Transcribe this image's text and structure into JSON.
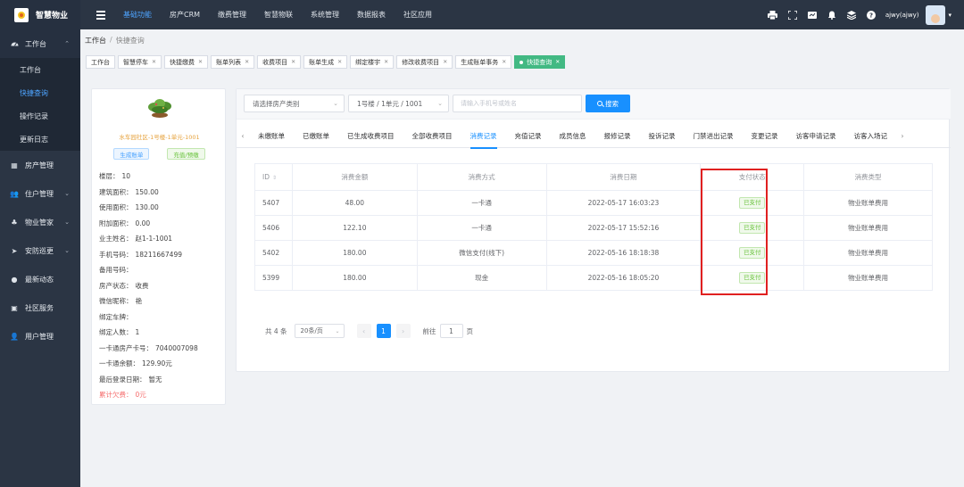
{
  "app": {
    "title": "智慧物业"
  },
  "topnav": [
    "基础功能",
    "房产CRM",
    "缴费管理",
    "智慧物联",
    "系统管理",
    "数据报表",
    "社区应用"
  ],
  "topnav_active": 0,
  "user": {
    "name": "ajwy(ajwy)"
  },
  "sidebar": {
    "workbench": {
      "label": "工作台",
      "items": [
        "工作台",
        "快捷查询",
        "操作记录",
        "更新日志"
      ],
      "active": 1
    },
    "groups": [
      "房产管理",
      "住户管理",
      "物业管家",
      "安防巡更",
      "最新动态",
      "社区服务",
      "用户管理"
    ]
  },
  "breadcrumb": {
    "root": "工作台",
    "sep": "/",
    "current": "快捷查询"
  },
  "tabs": [
    "工作台",
    "智慧停车",
    "快捷缴费",
    "账单列表",
    "收费项目",
    "账单生成",
    "绑定楼宇",
    "修改收费项目",
    "生成账单事务",
    "快捷查询"
  ],
  "house": {
    "name": "水车园社区-1号楼-1单元-1001",
    "btn_generate": "生成账单",
    "btn_recharge": "充值/预缴",
    "fields": [
      {
        "k": "楼层：",
        "v": "10"
      },
      {
        "k": "建筑面积：",
        "v": "150.00"
      },
      {
        "k": "使用面积：",
        "v": "130.00"
      },
      {
        "k": "附加面积：",
        "v": "0.00"
      },
      {
        "k": "业主姓名：",
        "v": "赵1-1-1001"
      },
      {
        "k": "手机号码：",
        "v": "18211667499"
      },
      {
        "k": "备用号码：",
        "v": ""
      },
      {
        "k": "房产状态：",
        "v": "收费"
      },
      {
        "k": "微信昵称：",
        "v": "艳"
      },
      {
        "k": "绑定车牌：",
        "v": ""
      },
      {
        "k": "绑定人数：",
        "v": "1"
      },
      {
        "k": "一卡通房产卡号：",
        "v": "7040007098"
      },
      {
        "k": "一卡通余额：",
        "v": "129.90元"
      },
      {
        "k": "最后登录日期：",
        "v": "暂无"
      }
    ],
    "arrears": {
      "k": "累计欠费：",
      "v": "0元"
    }
  },
  "filter": {
    "house_type_placeholder": "请选择房产类别",
    "building": "1号楼 / 1单元 / 1001",
    "search_placeholder": "请输入手机号或姓名",
    "search_label": "搜索"
  },
  "subtabs": [
    "未缴账单",
    "已缴账单",
    "已生成收费项目",
    "全部收费项目",
    "消费记录",
    "充值记录",
    "成员信息",
    "报修记录",
    "投诉记录",
    "门禁进出记录",
    "变更记录",
    "访客申请记录",
    "访客入场记"
  ],
  "subtab_active": 4,
  "table": {
    "headers": [
      "ID",
      "消费金额",
      "消费方式",
      "消费日期",
      "支付状态",
      "消费类型"
    ],
    "rows": [
      [
        "5407",
        "48.00",
        "一卡通",
        "2022-05-17 16:03:23",
        "已支付",
        "物业账单费用"
      ],
      [
        "5406",
        "122.10",
        "一卡通",
        "2022-05-17 15:52:16",
        "已支付",
        "物业账单费用"
      ],
      [
        "5402",
        "180.00",
        "微信支付(线下)",
        "2022-05-16 18:18:38",
        "已支付",
        "物业账单费用"
      ],
      [
        "5399",
        "180.00",
        "现金",
        "2022-05-16 18:05:20",
        "已支付",
        "物业账单费用"
      ]
    ]
  },
  "pager": {
    "total": "共 4 条",
    "page_size": "20条/页",
    "current": "1",
    "goto_label": "前往",
    "goto_value": "1",
    "page_unit": "页"
  },
  "colors": {
    "topbar": "#2b3544",
    "accent": "#1890ff",
    "active_tab": "#42b983",
    "success": "#67c23a",
    "warning": "#e6a23c",
    "danger": "#f56c6c",
    "highlight": "#e02020"
  }
}
